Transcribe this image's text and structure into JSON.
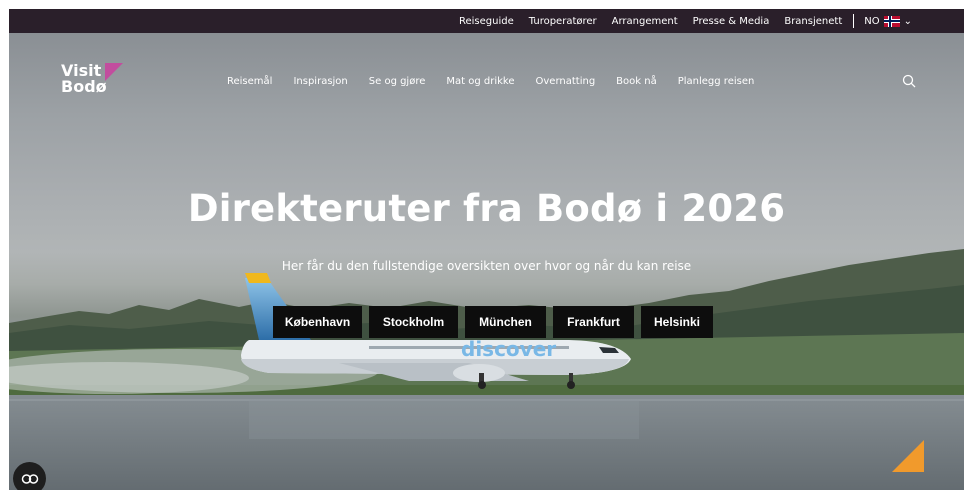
{
  "topbar": {
    "links": [
      "Reiseguide",
      "Turoperatører",
      "Arrangement",
      "Presse & Media",
      "Bransjenett"
    ],
    "language": "NO",
    "flag_icon": "norway-flag-icon",
    "colors": {
      "background": "#2a1f2a",
      "text": "#ffffff"
    }
  },
  "header": {
    "logo_line1": "Visit",
    "logo_line2": "Bodø",
    "logo_accent_color": "#c24d9e",
    "nav": [
      "Reisemål",
      "Inspirasjon",
      "Se og gjøre",
      "Mat og drikke",
      "Overnatting",
      "Book nå",
      "Planlegg reisen"
    ],
    "search_icon": "search-icon"
  },
  "hero": {
    "title": "Direkteruter fra Bodø i 2026",
    "subtitle": "Her får du den fullstendige oversikten over hvor og når du kan reise",
    "plane_livery_text": "discover",
    "cities": [
      "København",
      "Stockholm",
      "München",
      "Frankfurt",
      "Helsinki"
    ]
  },
  "widgets": {
    "cookie_icon": "cookie-settings-icon",
    "corner_icon": "orange-triangle-icon",
    "corner_color": "#f19a2c"
  }
}
